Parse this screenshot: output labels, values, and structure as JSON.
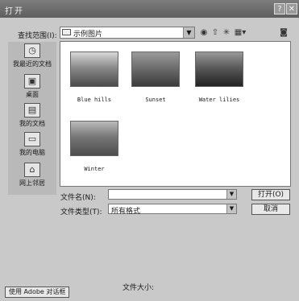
{
  "window": {
    "title": "打开",
    "help_glyph": "?",
    "close_glyph": "✕"
  },
  "lookin": {
    "label": "查找范围(I):",
    "value": "示例图片"
  },
  "places": [
    {
      "label": "我最近的文档",
      "icon": "recent-documents-icon"
    },
    {
      "label": "桌面",
      "icon": "desktop-icon"
    },
    {
      "label": "我的文档",
      "icon": "my-documents-icon"
    },
    {
      "label": "我的电脑",
      "icon": "my-computer-icon"
    },
    {
      "label": "网上邻居",
      "icon": "network-places-icon"
    }
  ],
  "files": [
    {
      "name": "Blue hills",
      "palette": [
        "#4a4a4a",
        "#8a8a8a",
        "#d8d8d8"
      ]
    },
    {
      "name": "Sunset",
      "palette": [
        "#3a3a3a",
        "#6e6e6e",
        "#9a9a9a"
      ]
    },
    {
      "name": "Water lilies",
      "palette": [
        "#222222",
        "#5a5a5a",
        "#999999"
      ]
    },
    {
      "name": "Winter",
      "palette": [
        "#4d4d4d",
        "#777777",
        "#bbbbbb"
      ]
    }
  ],
  "form": {
    "filename_label": "文件名(N):",
    "filename_value": "",
    "filetype_label": "文件类型(T):",
    "filetype_value": "所有格式",
    "open_label": "打开(O)",
    "cancel_label": "取消"
  },
  "footer": {
    "adobe_dialog_label": "使用 Adobe 对话框",
    "filesize_label": "文件大小:"
  }
}
